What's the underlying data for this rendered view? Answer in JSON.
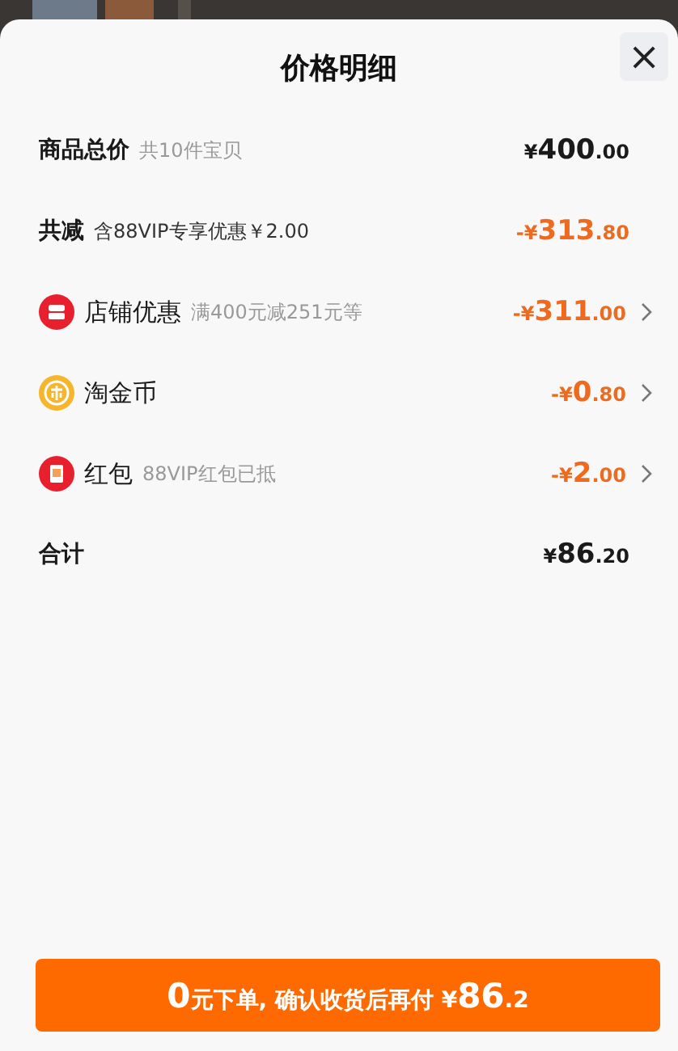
{
  "sheet": {
    "title": "价格明细",
    "close": "×"
  },
  "rows": [
    {
      "kind": "total",
      "label": "商品总价",
      "note": "共10件宝贝",
      "amount": {
        "sign": "¥",
        "main": "400",
        "cents": ".00"
      }
    },
    {
      "kind": "discount",
      "label": "共减",
      "note": "含88VIP专享优惠￥2.00",
      "amount": {
        "sign": "-¥",
        "main": "313",
        "cents": ".80"
      }
    },
    {
      "kind": "store",
      "label": "店铺优惠",
      "note": "满400元减251元等",
      "amount": {
        "sign": "-¥",
        "main": "311",
        "cents": ".00"
      }
    },
    {
      "kind": "coin",
      "label": "淘金币",
      "amount": {
        "sign": "-¥",
        "main": "0",
        "cents": ".80"
      }
    },
    {
      "kind": "packet",
      "label": "红包",
      "note": "88VIP红包已抵",
      "amount": {
        "sign": "-¥",
        "main": "2",
        "cents": ".00"
      }
    },
    {
      "kind": "total",
      "label": "合计",
      "amount": {
        "sign": "¥",
        "main": "86",
        "cents": ".20"
      }
    }
  ],
  "submit": {
    "parts": [
      {
        "text": "0",
        "big": true
      },
      {
        "text": "元下单, 确认收货后再付 ¥",
        "big": false
      },
      {
        "text": "86",
        "big": true
      },
      {
        "text": ".2",
        "big": false
      }
    ]
  }
}
